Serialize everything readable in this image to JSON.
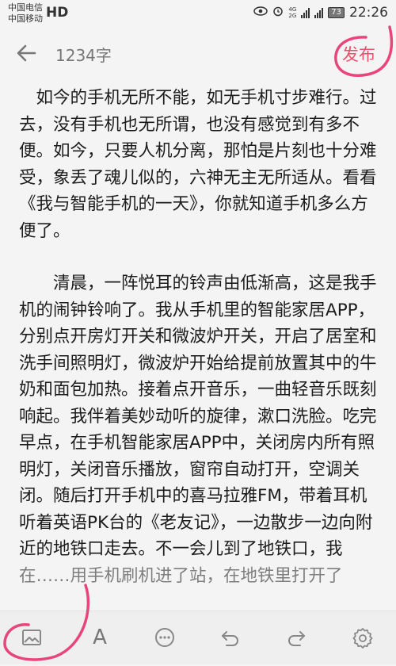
{
  "status_bar": {
    "carrier1": "中国电信",
    "carrier2": "中国移动",
    "hd_label": "HD",
    "battery": "73",
    "time": "22:26",
    "net_top": "4G",
    "net_bottom": "2G"
  },
  "header": {
    "word_count": "1234字",
    "publish_label": "发布"
  },
  "editor": {
    "paragraph1": "如今的手机无所不能，如无手机寸步难行。过去，没有手机也无所谓，也没有感觉到有多不便。如今，只要人机分离，那怕是片刻也十分难受，象丢了魂儿似的，六神无主无所适从。看看《我与智能手机的一天》，你就知道手机多么方便了。",
    "paragraph2": "清晨，一阵悦耳的铃声由低渐高，这是我手机的闹钟铃响了。我从手机里的智能家居APP，分别点开房灯开关和微波炉开关，开启了居室和洗手间照明灯，微波炉开始给提前放置其中的牛奶和面包加热。接着点开音乐，一曲轻音乐既刻响起。我伴着美妙动听的旋律，漱口洗脸。吃完早点，在手机智能家居APP中，关闭房内所有照明灯，关闭音乐播放，窗帘自动打开，空调关闭。随后打开手机中的喜马拉雅FM，带着耳机听着英语PK台的《老友记》，一边散步一边向附近的地铁口走去。不一会儿到了地铁口，我",
    "partial_line": "在……用手机刷机进了站，在地铁里打开了"
  },
  "toolbar": {
    "text_tool_label": "A"
  },
  "icons": {
    "back": "arrow-left-icon",
    "image": "image-icon",
    "text": "text-format-icon",
    "more": "more-icon",
    "undo": "undo-icon",
    "redo": "redo-icon",
    "settings": "gear-icon",
    "eye": "eye-icon",
    "alarm": "alarm-icon"
  },
  "colors": {
    "accent": "#ee4f6b",
    "background": "#f4f4f4",
    "icon_gray": "#888888",
    "annotation_pink": "#e8457a"
  }
}
